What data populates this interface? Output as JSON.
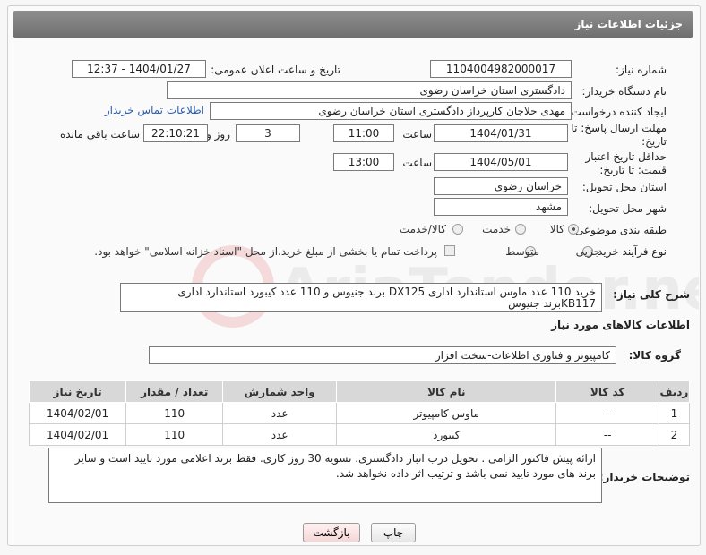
{
  "header": {
    "title": "جزئیات اطلاعات نیاز"
  },
  "need_number": {
    "label": "شماره نیاز:",
    "value": "1104004982000017"
  },
  "announce": {
    "label": "تاریخ و ساعت اعلان عمومی:",
    "value": "1404/01/27 - 12:37"
  },
  "buyer_org": {
    "label": "نام دستگاه خریدار:",
    "value": "دادگستری استان خراسان رضوی"
  },
  "creator": {
    "label": "ایجاد کننده درخواست:",
    "value": "مهدی حلاجان کارپرداز دادگستری استان خراسان رضوی",
    "contact_link": "اطلاعات تماس خریدار"
  },
  "deadline_send": {
    "label": "مهلت ارسال پاسخ: تا تاریخ:",
    "date": "1404/01/31",
    "time_label": "ساعت",
    "time": "11:00",
    "days": "3",
    "days_label": "روز و",
    "remaining": "22:10:21",
    "remaining_label": "ساعت باقی مانده"
  },
  "deadline_price": {
    "label": "حداقل تاریخ اعتبار قیمت: تا تاریخ:",
    "date": "1404/05/01",
    "time_label": "ساعت",
    "time": "13:00"
  },
  "province": {
    "label": "استان محل تحویل:",
    "value": "خراسان رضوی"
  },
  "city": {
    "label": "شهر محل تحویل:",
    "value": "مشهد"
  },
  "category": {
    "label": "طبقه بندی موضوعی:",
    "options": [
      "کالا",
      "خدمت",
      "کالا/خدمت"
    ],
    "selected": "کالا"
  },
  "purchase_type": {
    "label": "نوع فرآیند خرید :",
    "options": [
      "جزیی",
      "متوسط"
    ],
    "selected": "جزیی",
    "treasury_note": "پرداخت تمام یا بخشی از مبلغ خرید،از محل \"اسناد خزانه اسلامی\" خواهد بود."
  },
  "summary": {
    "label": "شرح کلی نیاز:",
    "value": "خرید 110 عدد ماوس استاندارد اداری DX125 برند جنیوس و 110 عدد کیبورد استاندارد اداری  KB117برند جنیوس"
  },
  "goods_info": {
    "title": "اطلاعات کالاهای مورد نیاز"
  },
  "goods_group": {
    "label": "گروه کالا:",
    "value": "کامپیوتر و فناوری اطلاعات-سخت افزار"
  },
  "table": {
    "headers": [
      "ردیف",
      "کد کالا",
      "نام کالا",
      "واحد شمارش",
      "تعداد / مقدار",
      "تاریخ نیاز"
    ],
    "rows": [
      [
        "1",
        "--",
        "ماوس کامپیوتر",
        "عدد",
        "110",
        "1404/02/01"
      ],
      [
        "2",
        "--",
        "کیبورد",
        "عدد",
        "110",
        "1404/02/01"
      ]
    ]
  },
  "buyer_notes": {
    "label": "توضیحات خریدار:",
    "value": "ارائه پیش فاکتور الزامی . تحویل درب انبار دادگستری. تسویه 30 روز کاری. فقط برند اعلامی مورد تایید است و سایر برند های مورد تایید نمی باشد و ترتیب اثر داده نخواهد شد."
  },
  "buttons": {
    "print": "چاپ",
    "back": "بازگشت"
  },
  "watermark": {
    "text": "AriaTender.neT"
  }
}
